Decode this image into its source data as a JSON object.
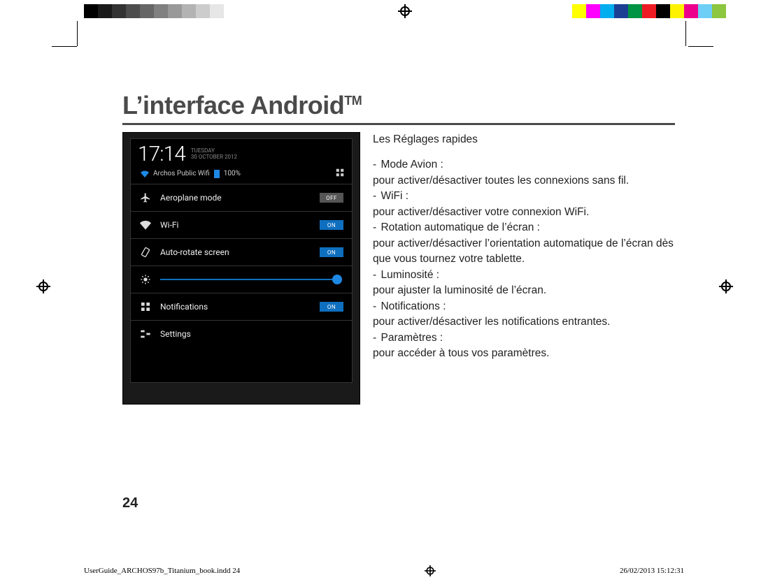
{
  "title_main": "L’interface Android",
  "title_tm": "TM",
  "page_number": "24",
  "footer_left": "UserGuide_ARCHOS97b_Titanium_book.indd   24",
  "footer_right": "26/02/2013   15:12:31",
  "screenshot": {
    "clock": "17:14",
    "day": "TUESDAY",
    "date": "30 OCTOBER 2012",
    "ssid": "Archos Public Wifi",
    "battery": "100%",
    "items": {
      "airplane": {
        "label": "Aeroplane mode",
        "toggle": "OFF"
      },
      "wifi": {
        "label": "Wi-Fi",
        "toggle": "ON"
      },
      "rotate": {
        "label": "Auto-rotate screen",
        "toggle": "ON"
      },
      "brightness": {
        "label": ""
      },
      "notif": {
        "label": "Notifications",
        "toggle": "ON"
      },
      "settings": {
        "label": "Settings"
      }
    }
  },
  "desc": {
    "heading": "Les Réglages rapides",
    "airplane_t": "Mode Avion :",
    "airplane_b": "pour activer/désactiver toutes les connexions sans fil.",
    "wifi_t": "WiFi :",
    "wifi_b": "pour activer/désactiver votre connexion WiFi.",
    "rotate_t": "Rotation automatique de l’écran :",
    "rotate_b": "pour activer/désactiver l’orientation automatique de l’écran dès que vous tournez votre tablette.",
    "bright_t": "Luminosité :",
    "bright_b": "pour ajuster la luminosité de l’écran.",
    "notif_t": "Notifications :",
    "notif_b": "pour activer/désactiver les notifications entrantes.",
    "settings_t": "Paramètres :",
    "settings_b": "pour accéder à tous vos paramètres."
  },
  "colorbar_left": [
    "#000000",
    "#1a1a1a",
    "#333333",
    "#4d4d4d",
    "#666666",
    "#808080",
    "#999999",
    "#b3b3b3",
    "#cccccc",
    "#e6e6e6",
    "#ffffff"
  ],
  "colorbar_right": [
    "#ffff00",
    "#ff00ff",
    "#00aeef",
    "#1c3f94",
    "#009444",
    "#ed1c24",
    "#000000",
    "#fff200",
    "#ec008c",
    "#6dcff6",
    "#8dc63f"
  ]
}
